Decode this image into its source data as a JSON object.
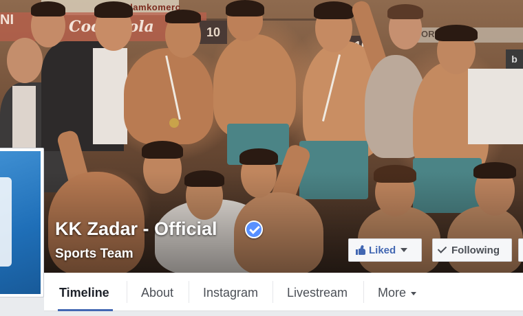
{
  "cover": {
    "banner_top_text": "Plamkomerc",
    "banner_cola_text": "Coca-Cola",
    "banner_left_text": "NI",
    "scoreboard_1": "10",
    "scoreboard_2": "10",
    "banner_right_text": "ORPO",
    "side_sign_text": "b"
  },
  "profile": {
    "name": "KK Zadar - Official",
    "category": "Sports Team",
    "verified_icon": "verified-badge-icon",
    "accent_color": "#5890ff"
  },
  "actions": {
    "liked_label": "Liked",
    "following_label": "Following",
    "liked_color": "#4267b2"
  },
  "tabs": [
    {
      "label": "Timeline",
      "active": true
    },
    {
      "label": "About"
    },
    {
      "label": "Instagram"
    },
    {
      "label": "Livestream"
    },
    {
      "label": "More"
    }
  ]
}
